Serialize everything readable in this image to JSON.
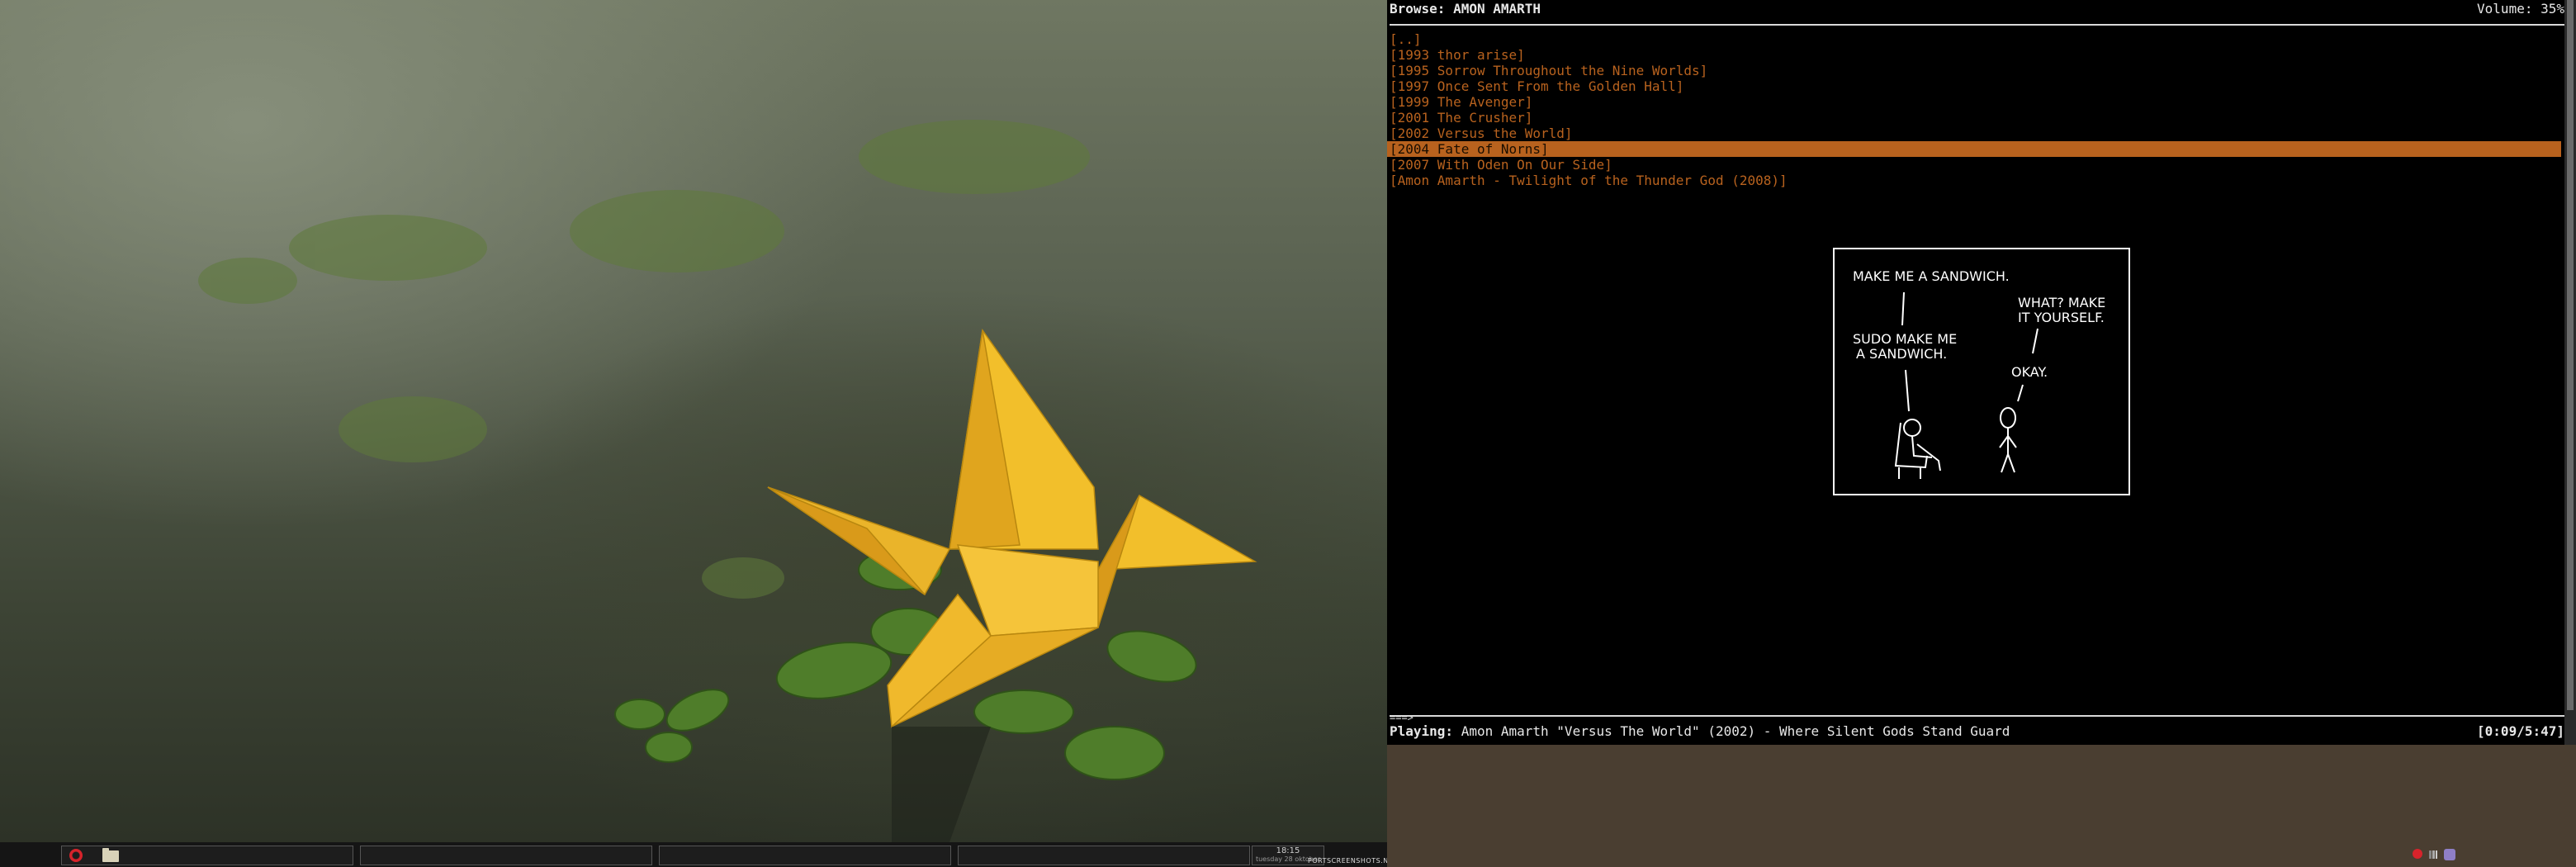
{
  "desktop": {
    "taskbar": {
      "clock_time": "18:15",
      "clock_date": "tuesday 28 oktober",
      "watermark": "PORTSCREENSHOTS.NET"
    }
  },
  "terminal": {
    "header_title": "Browse: AMON AMARTH",
    "volume": "Volume: 35%",
    "items": [
      {
        "label": "[..]"
      },
      {
        "label": "[1993 thor arise]"
      },
      {
        "label": "[1995 Sorrow Throughout the Nine Worlds]"
      },
      {
        "label": "[1997 Once Sent From the Golden Hall]"
      },
      {
        "label": "[1999 The Avenger]"
      },
      {
        "label": "[2001 The Crusher]"
      },
      {
        "label": "[2002 Versus the World]"
      },
      {
        "label": "[2004 Fate of Norns]"
      },
      {
        "label": "[2007 With Oden On Our Side]"
      },
      {
        "label": "[Amon Amarth - Twilight of the Thunder God (2008)]"
      }
    ],
    "selected_index": 7,
    "progress_indicator": "===>",
    "status": {
      "label": "Playing:",
      "track": "Amon Amarth \"Versus The World\" (2002) - Where Silent Gods Stand Guard",
      "time": "[0:09/5:47]"
    }
  },
  "comic": {
    "line1": "MAKE ME A SANDWICH.",
    "line2a": "WHAT? MAKE",
    "line2b": "IT YOURSELF.",
    "line3a": "SUDO MAKE ME",
    "line3b": "A SANDWICH.",
    "line4": "OKAY."
  },
  "colors": {
    "list_fg": "#b8621e",
    "selected_bg": "#b8621e",
    "lower_panel": "#4a3e31"
  }
}
